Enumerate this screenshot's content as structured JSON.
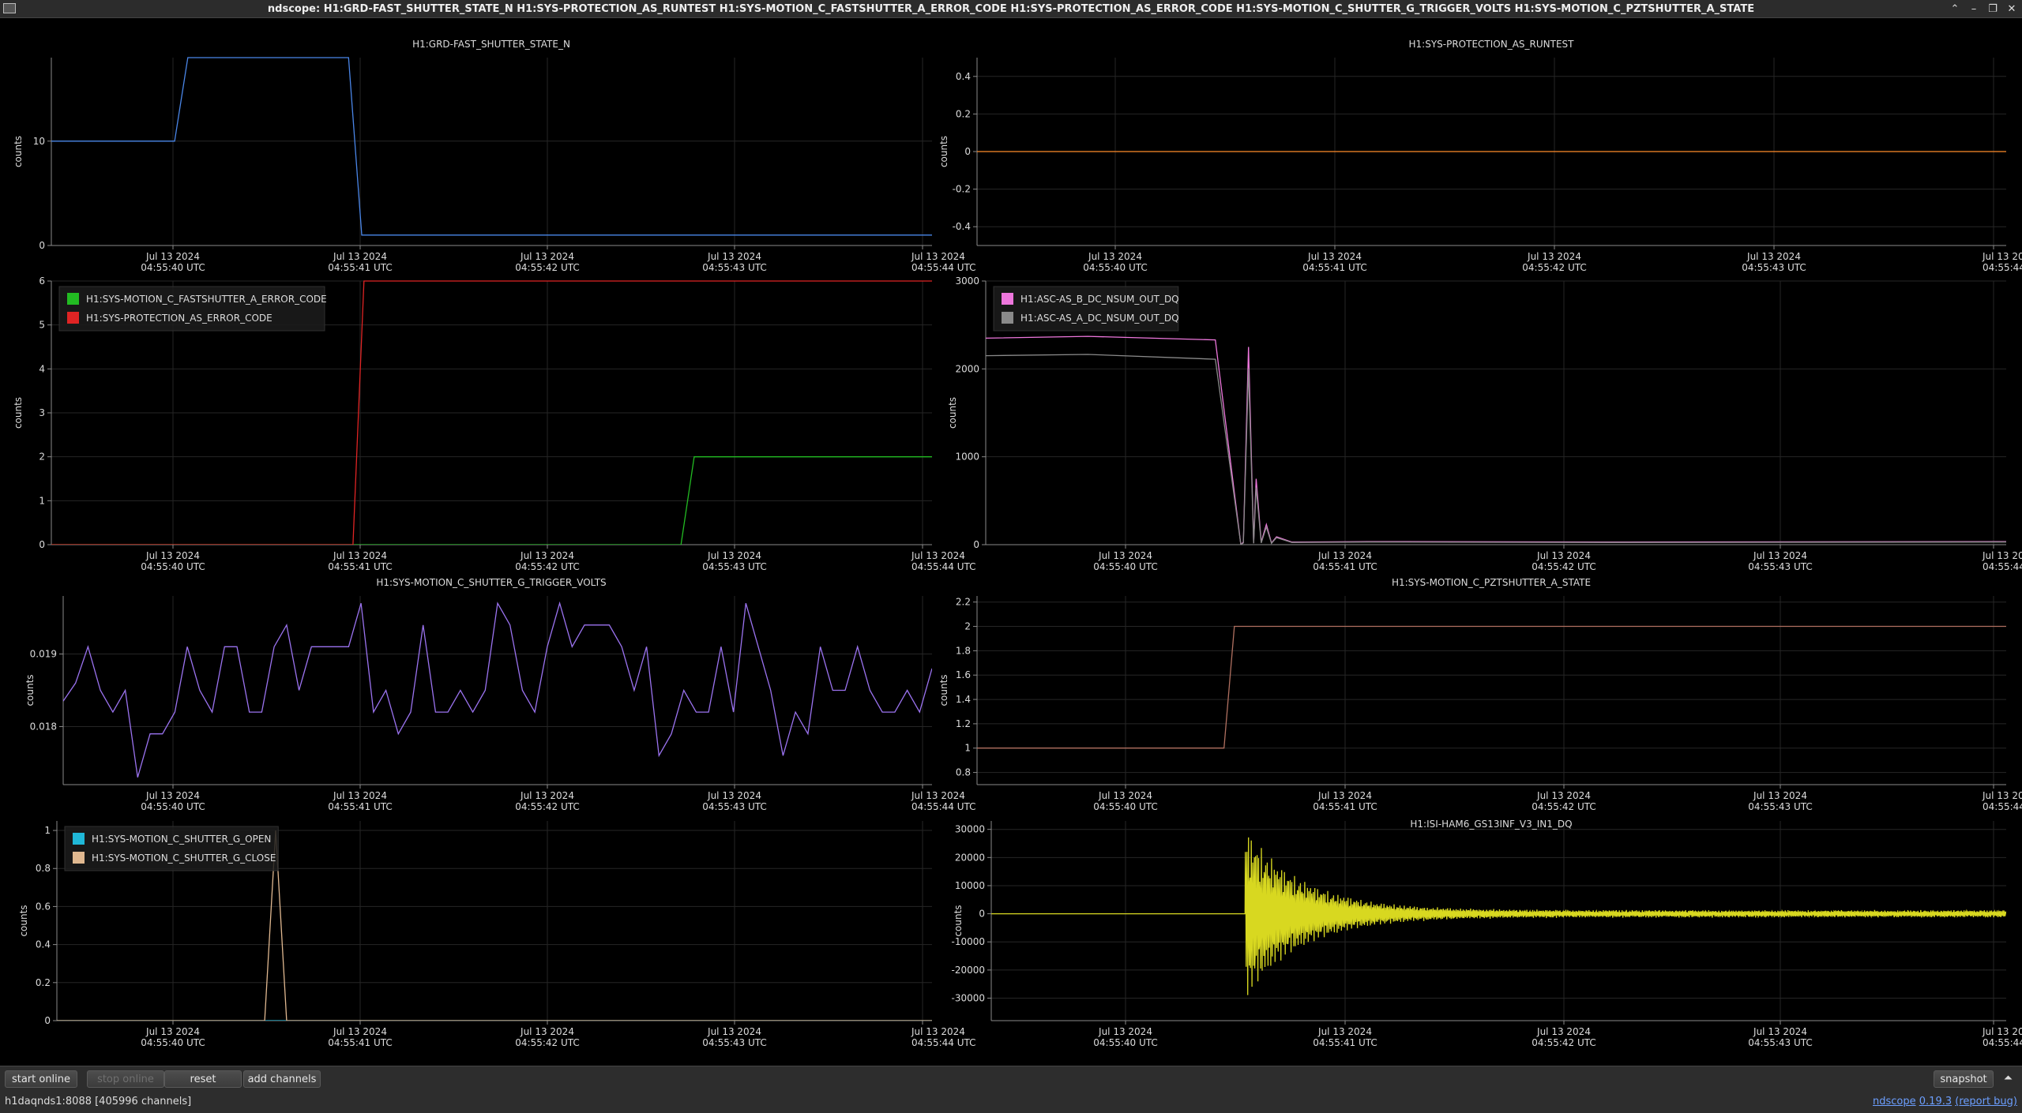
{
  "window": {
    "title": "ndscope: H1:GRD-FAST_SHUTTER_STATE_N H1:SYS-PROTECTION_AS_RUNTEST H1:SYS-MOTION_C_FASTSHUTTER_A_ERROR_CODE H1:SYS-PROTECTION_AS_ERROR_CODE H1:SYS-MOTION_C_SHUTTER_G_TRIGGER_VOLTS H1:SYS-MOTION_C_PZTSHUTTER_A_STATE",
    "controls": [
      "⌃",
      "–",
      "❐",
      "✕"
    ]
  },
  "time_axis": {
    "ticks": [
      {
        "date": "Jul 13 2024",
        "time": "04:55:40 UTC"
      },
      {
        "date": "Jul 13 2024",
        "time": "04:55:41 UTC"
      },
      {
        "date": "Jul 13 2024",
        "time": "04:55:42 UTC"
      },
      {
        "date": "Jul 13 2024",
        "time": "04:55:43 UTC"
      },
      {
        "date": "Jul 13 2024",
        "time": "04:55:44 UTC"
      }
    ]
  },
  "colors": {
    "background": "#000000",
    "grid": "#262626",
    "axis": "#8a8a8a",
    "blue": "#4a86e8",
    "orange": "#ff8c2a",
    "green": "#22bb22",
    "red": "#e02424",
    "purple": "#9b73f0",
    "pink": "#ee77dd",
    "gray": "#8a8a8a",
    "brown": "#b07060",
    "cyan": "#20b8d8",
    "tan": "#e0b890",
    "yellow": "#d8d820"
  },
  "chart_data": [
    {
      "type": "line",
      "title": "H1:GRD-FAST_SHUTTER_STATE_N",
      "ylabel": "counts",
      "yticks": [
        "0",
        "10"
      ],
      "ylim": [
        0,
        18
      ],
      "x_time_s": [
        0,
        0.56,
        0.62,
        1.35,
        1.41,
        4.0
      ],
      "series": [
        {
          "color": "blue",
          "values": [
            10,
            10,
            18,
            18,
            1,
            1
          ]
        }
      ]
    },
    {
      "type": "line",
      "title": "H1:SYS-PROTECTION_AS_RUNTEST",
      "ylabel": "counts",
      "yticks": [
        "-0.4",
        "-0.2",
        "0",
        "0.2",
        "0.4"
      ],
      "ylim": [
        -0.5,
        0.5
      ],
      "x_time_s": [
        0,
        4.0
      ],
      "series": [
        {
          "color": "orange",
          "values": [
            0,
            0
          ]
        }
      ]
    },
    {
      "type": "line",
      "title": "",
      "ylabel": "counts",
      "yticks": [
        "0",
        "1",
        "2",
        "3",
        "4",
        "5",
        "6"
      ],
      "ylim": [
        0,
        6
      ],
      "x_time_s": [
        0,
        1.37,
        1.42,
        2.86,
        2.92,
        4.0
      ],
      "legend": [
        {
          "name": "H1:SYS-MOTION_C_FASTSHUTTER_A_ERROR_CODE",
          "color": "green"
        },
        {
          "name": "H1:SYS-PROTECTION_AS_ERROR_CODE",
          "color": "red"
        }
      ],
      "series": [
        {
          "name": "H1:SYS-MOTION_C_FASTSHUTTER_A_ERROR_CODE",
          "color": "green",
          "values": [
            0,
            0,
            0,
            0,
            2,
            2
          ]
        },
        {
          "name": "H1:SYS-PROTECTION_AS_ERROR_CODE",
          "color": "red",
          "values": [
            0,
            0,
            6,
            6,
            6,
            6
          ]
        }
      ]
    },
    {
      "type": "line",
      "title": "",
      "ylabel": "counts",
      "yticks": [
        "0",
        "1000",
        "2000",
        "3000"
      ],
      "ylim": [
        0,
        3000
      ],
      "x_time_s": [
        0.0,
        0.4,
        0.9,
        1.0,
        1.01,
        1.03,
        1.05,
        1.06,
        1.08,
        1.1,
        1.12,
        1.14,
        1.2,
        1.5,
        2.5,
        4.0
      ],
      "legend": [
        {
          "name": "H1:ASC-AS_B_DC_NSUM_OUT_DQ",
          "color": "pink"
        },
        {
          "name": "H1:ASC-AS_A_DC_NSUM_OUT_DQ",
          "color": "gray"
        }
      ],
      "series": [
        {
          "name": "H1:ASC-AS_B_DC_NSUM_OUT_DQ",
          "color": "pink",
          "values": [
            2350,
            2370,
            2330,
            0,
            30,
            2250,
            20,
            750,
            30,
            230,
            20,
            90,
            30,
            35,
            30,
            35
          ]
        },
        {
          "name": "H1:ASC-AS_A_DC_NSUM_OUT_DQ",
          "color": "gray",
          "values": [
            2150,
            2165,
            2110,
            0,
            20,
            2000,
            15,
            650,
            20,
            200,
            15,
            80,
            25,
            30,
            25,
            30
          ]
        }
      ]
    },
    {
      "type": "line",
      "title": "H1:SYS-MOTION_C_SHUTTER_G_TRIGGER_VOLTS",
      "ylabel": "counts",
      "yticks": [
        "0.018",
        "0.019"
      ],
      "ylim": [
        0.0172,
        0.0198
      ],
      "series": [
        {
          "color": "purple",
          "values": [
            0.01835,
            0.0186,
            0.0191,
            0.0185,
            0.0182,
            0.0185,
            0.0173,
            0.0179,
            0.0179,
            0.0182,
            0.0191,
            0.0185,
            0.0182,
            0.0191,
            0.0191,
            0.0182,
            0.0182,
            0.0191,
            0.0194,
            0.0185,
            0.0191,
            0.0191,
            0.0191,
            0.0191,
            0.0197,
            0.0182,
            0.0185,
            0.0179,
            0.0182,
            0.0194,
            0.0182,
            0.0182,
            0.0185,
            0.0182,
            0.0185,
            0.0197,
            0.0194,
            0.0185,
            0.0182,
            0.0191,
            0.0197,
            0.0191,
            0.0194,
            0.0194,
            0.0194,
            0.0191,
            0.0185,
            0.0191,
            0.0176,
            0.0179,
            0.0185,
            0.0182,
            0.0182,
            0.0191,
            0.0182,
            0.0197,
            0.0191,
            0.0185,
            0.0176,
            0.0182,
            0.0179,
            0.0191,
            0.0185,
            0.0185,
            0.0191,
            0.0185,
            0.0182,
            0.0182,
            0.0185,
            0.0182,
            0.0188
          ]
        }
      ]
    },
    {
      "type": "line",
      "title": "H1:SYS-MOTION_C_PZTSHUTTER_A_STATE",
      "ylabel": "counts",
      "yticks": [
        "0.8",
        "1",
        "1.2",
        "1.4",
        "1.6",
        "1.8",
        "2",
        "2.2"
      ],
      "ylim": [
        0.7,
        2.25
      ],
      "x_time_s": [
        0,
        0.96,
        1.0,
        4.0
      ],
      "series": [
        {
          "color": "brown",
          "values": [
            1,
            1,
            2,
            2
          ]
        }
      ]
    },
    {
      "type": "line",
      "title": "",
      "ylabel": "counts",
      "yticks": [
        "0",
        "0.2",
        "0.4",
        "0.6",
        "0.8",
        "1"
      ],
      "ylim": [
        0,
        1.05
      ],
      "x_time_s": [
        0,
        0.95,
        1.0,
        1.05,
        4.0
      ],
      "legend": [
        {
          "name": "H1:SYS-MOTION_C_SHUTTER_G_OPEN",
          "color": "cyan"
        },
        {
          "name": "H1:SYS-MOTION_C_SHUTTER_G_CLOSE",
          "color": "tan"
        }
      ],
      "series": [
        {
          "name": "H1:SYS-MOTION_C_SHUTTER_G_OPEN",
          "color": "cyan",
          "values": [
            0,
            0,
            0,
            0,
            0
          ]
        },
        {
          "name": "H1:SYS-MOTION_C_SHUTTER_G_CLOSE",
          "color": "tan",
          "values": [
            0,
            0,
            1,
            0,
            0
          ]
        }
      ]
    },
    {
      "type": "line",
      "title": "H1:ISI-HAM6_GS13INF_V3_IN1_DQ",
      "ylabel": "counts",
      "yticks": [
        "-30000",
        "-20000",
        "-10000",
        "0",
        "10000",
        "20000",
        "30000"
      ],
      "ylim": [
        -38000,
        33000
      ],
      "series": [
        {
          "color": "yellow",
          "signal": "flat at 0 before the shutter event, then a decaying oscillation with peak amplitude about 30000 settling to a small noise band"
        }
      ]
    }
  ],
  "toolbar": {
    "start_online": "start online",
    "stop_online": "stop online",
    "reset": "reset",
    "add_channels": "add channels",
    "snapshot": "snapshot",
    "collapse": "⏶"
  },
  "status": {
    "server": "h1daqnds1:8088  [405996 channels]",
    "app_name": "ndscope",
    "version": "0.19.3",
    "report_bug": "(report bug)"
  }
}
